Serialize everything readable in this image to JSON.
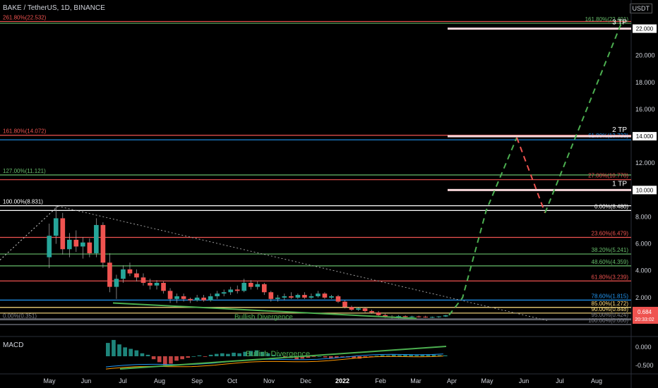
{
  "header": {
    "symbol": "BAKE / TetherUS, 1D, BINANCE",
    "unit": "USDT"
  },
  "macd": {
    "title": "MACD",
    "ticks": [
      "0.000",
      "-0.500"
    ]
  },
  "colors": {
    "up": "#26a69a",
    "down": "#ef5350",
    "wick": "#b0b0b0"
  },
  "chart_data": {
    "type": "candlestick",
    "x_labels": [
      "May",
      "Jun",
      "Jul",
      "Aug",
      "Sep",
      "Oct",
      "Nov",
      "Dec",
      "2022",
      "Feb",
      "Mar",
      "Apr",
      "May",
      "Jun",
      "Jul",
      "Aug"
    ],
    "y_ticks": [
      "22.000",
      "20.000",
      "18.000",
      "16.000",
      "14.000",
      "12.000",
      "10.000",
      "8.000",
      "6.000",
      "4.000",
      "2.000"
    ],
    "ylim": [
      0,
      23.5
    ],
    "price_label": {
      "value": "0.684",
      "countdown": "20:33:02"
    },
    "fib_left": [
      {
        "label": "261.80%(22.532)",
        "value": 22.532,
        "color": "#ef5350"
      },
      {
        "label": "161.80%(14.072)",
        "value": 14.072,
        "color": "#ef5350"
      },
      {
        "label": "127.00%(11.121)",
        "value": 11.121,
        "color": "#66bb6a"
      },
      {
        "label": "100.00%(8.831)",
        "value": 8.831,
        "color": "#ffffff"
      },
      {
        "label": "0.00%(0.351)",
        "value": 0.351,
        "color": "#787b86"
      }
    ],
    "fib_right": [
      {
        "label": "161.80%(22.401)",
        "value": 22.401,
        "color": "#66bb6a"
      },
      {
        "label": "61.80%(13.733)",
        "value": 13.733,
        "color": "#2196f3"
      },
      {
        "label": "27.00%(10.770)",
        "value": 10.77,
        "color": "#ef5350"
      },
      {
        "label": "0.00%(8.480)",
        "value": 8.48,
        "color": "#ffffff"
      },
      {
        "label": "23.60%(6.479)",
        "value": 6.479,
        "color": "#ef5350"
      },
      {
        "label": "38.20%(5.241)",
        "value": 5.241,
        "color": "#66bb6a"
      },
      {
        "label": "48.60%(4.359)",
        "value": 4.359,
        "color": "#66bb6a"
      },
      {
        "label": "61.80%(3.239)",
        "value": 3.239,
        "color": "#ef5350"
      },
      {
        "label": "78.60%(1.815)",
        "value": 1.815,
        "color": "#2196f3"
      },
      {
        "label": "85.00%(1.272)",
        "value": 1.272,
        "color": "#ffe082"
      },
      {
        "label": "90.00%(0.848)",
        "value": 0.848,
        "color": "#ffe082"
      },
      {
        "label": "95.00%(0.424)",
        "value": 0.424,
        "color": "#787b86"
      },
      {
        "label": "100.00%(0.000)",
        "value": 0.0,
        "color": "#787b86"
      }
    ],
    "targets": [
      {
        "label": "3 TP",
        "value": 22.0,
        "tag": "22.000"
      },
      {
        "label": "2 TP",
        "value": 14.0,
        "tag": "14.000"
      },
      {
        "label": "1 TP",
        "value": 10.0,
        "tag": "10.000"
      }
    ],
    "targets_axis": [
      "22.000",
      "14.000",
      "10.000"
    ],
    "annotations": [
      "Bullish Divergence",
      "Bullish Divergence"
    ],
    "candles": [
      {
        "o": 5.0,
        "h": 7.5,
        "l": 4.2,
        "c": 6.6
      },
      {
        "o": 6.6,
        "h": 8.8,
        "l": 6.0,
        "c": 7.9
      },
      {
        "o": 7.9,
        "h": 8.3,
        "l": 5.2,
        "c": 5.6
      },
      {
        "o": 5.6,
        "h": 6.8,
        "l": 5.0,
        "c": 6.3
      },
      {
        "o": 6.3,
        "h": 7.0,
        "l": 5.4,
        "c": 5.8
      },
      {
        "o": 5.8,
        "h": 6.5,
        "l": 4.9,
        "c": 6.1
      },
      {
        "o": 6.1,
        "h": 6.4,
        "l": 5.0,
        "c": 5.3
      },
      {
        "o": 5.3,
        "h": 7.9,
        "l": 5.0,
        "c": 7.4
      },
      {
        "o": 7.4,
        "h": 7.6,
        "l": 4.2,
        "c": 4.6
      },
      {
        "o": 4.6,
        "h": 5.3,
        "l": 2.4,
        "c": 2.8
      },
      {
        "o": 2.8,
        "h": 3.7,
        "l": 1.9,
        "c": 3.4
      },
      {
        "o": 3.4,
        "h": 4.4,
        "l": 3.1,
        "c": 4.1
      },
      {
        "o": 4.1,
        "h": 4.6,
        "l": 3.6,
        "c": 3.8
      },
      {
        "o": 3.8,
        "h": 4.1,
        "l": 3.2,
        "c": 3.5
      },
      {
        "o": 3.5,
        "h": 3.8,
        "l": 2.9,
        "c": 3.1
      },
      {
        "o": 3.1,
        "h": 3.4,
        "l": 2.6,
        "c": 2.9
      },
      {
        "o": 2.9,
        "h": 3.3,
        "l": 2.6,
        "c": 3.1
      },
      {
        "o": 3.1,
        "h": 3.2,
        "l": 2.3,
        "c": 2.5
      },
      {
        "o": 2.5,
        "h": 2.7,
        "l": 1.6,
        "c": 1.9
      },
      {
        "o": 1.9,
        "h": 2.3,
        "l": 1.6,
        "c": 2.1
      },
      {
        "o": 2.1,
        "h": 2.3,
        "l": 1.7,
        "c": 1.9
      },
      {
        "o": 1.9,
        "h": 2.0,
        "l": 1.6,
        "c": 1.8
      },
      {
        "o": 1.8,
        "h": 2.2,
        "l": 1.7,
        "c": 2.0
      },
      {
        "o": 2.0,
        "h": 2.2,
        "l": 1.7,
        "c": 1.8
      },
      {
        "o": 1.8,
        "h": 2.3,
        "l": 1.7,
        "c": 2.1
      },
      {
        "o": 2.1,
        "h": 2.5,
        "l": 1.9,
        "c": 2.3
      },
      {
        "o": 2.3,
        "h": 2.6,
        "l": 2.1,
        "c": 2.4
      },
      {
        "o": 2.4,
        "h": 2.8,
        "l": 2.2,
        "c": 2.6
      },
      {
        "o": 2.6,
        "h": 2.9,
        "l": 2.3,
        "c": 2.5
      },
      {
        "o": 2.5,
        "h": 3.4,
        "l": 2.4,
        "c": 3.1
      },
      {
        "o": 3.1,
        "h": 3.3,
        "l": 2.6,
        "c": 2.8
      },
      {
        "o": 2.8,
        "h": 3.2,
        "l": 2.6,
        "c": 3.0
      },
      {
        "o": 3.0,
        "h": 3.1,
        "l": 2.2,
        "c": 2.4
      },
      {
        "o": 2.4,
        "h": 2.5,
        "l": 1.7,
        "c": 1.9
      },
      {
        "o": 1.9,
        "h": 2.2,
        "l": 1.7,
        "c": 2.0
      },
      {
        "o": 2.0,
        "h": 2.3,
        "l": 1.8,
        "c": 2.1
      },
      {
        "o": 2.1,
        "h": 2.4,
        "l": 1.9,
        "c": 2.0
      },
      {
        "o": 2.0,
        "h": 2.3,
        "l": 1.9,
        "c": 2.2
      },
      {
        "o": 2.2,
        "h": 2.4,
        "l": 1.9,
        "c": 2.0
      },
      {
        "o": 2.0,
        "h": 2.3,
        "l": 1.9,
        "c": 2.1
      },
      {
        "o": 2.1,
        "h": 2.5,
        "l": 2.0,
        "c": 2.3
      },
      {
        "o": 2.3,
        "h": 2.4,
        "l": 1.9,
        "c": 2.0
      },
      {
        "o": 2.0,
        "h": 2.2,
        "l": 1.9,
        "c": 2.1
      },
      {
        "o": 2.1,
        "h": 2.2,
        "l": 1.6,
        "c": 1.7
      },
      {
        "o": 1.7,
        "h": 1.8,
        "l": 1.2,
        "c": 1.3
      },
      {
        "o": 1.3,
        "h": 1.4,
        "l": 1.0,
        "c": 1.1
      },
      {
        "o": 1.1,
        "h": 1.3,
        "l": 1.0,
        "c": 1.2
      },
      {
        "o": 1.2,
        "h": 1.3,
        "l": 0.9,
        "c": 1.0
      },
      {
        "o": 1.0,
        "h": 1.1,
        "l": 0.8,
        "c": 0.9
      },
      {
        "o": 0.9,
        "h": 1.0,
        "l": 0.6,
        "c": 0.7
      },
      {
        "o": 0.7,
        "h": 0.8,
        "l": 0.5,
        "c": 0.6
      },
      {
        "o": 0.6,
        "h": 0.7,
        "l": 0.45,
        "c": 0.55
      },
      {
        "o": 0.55,
        "h": 0.7,
        "l": 0.45,
        "c": 0.62
      },
      {
        "o": 0.62,
        "h": 0.68,
        "l": 0.5,
        "c": 0.56
      },
      {
        "o": 0.56,
        "h": 0.65,
        "l": 0.5,
        "c": 0.6
      },
      {
        "o": 0.6,
        "h": 0.66,
        "l": 0.52,
        "c": 0.58
      },
      {
        "o": 0.58,
        "h": 0.65,
        "l": 0.5,
        "c": 0.55
      },
      {
        "o": 0.55,
        "h": 0.6,
        "l": 0.48,
        "c": 0.56
      },
      {
        "o": 0.56,
        "h": 0.62,
        "l": 0.5,
        "c": 0.6
      },
      {
        "o": 0.6,
        "h": 0.72,
        "l": 0.56,
        "c": 0.68
      }
    ],
    "projection": {
      "green_1": [
        [
          0.0,
          0.7
        ],
        [
          0.2,
          2.0
        ],
        [
          0.55,
          8.5
        ],
        [
          1.0,
          13.9
        ]
      ],
      "red_down": [
        [
          0.0,
          13.9
        ],
        [
          1.0,
          8.3
        ]
      ],
      "green_2": [
        [
          0.0,
          8.3
        ],
        [
          1.0,
          22.4
        ]
      ]
    },
    "macd_hist": [
      0.45,
      0.55,
      0.4,
      0.3,
      0.25,
      0.2,
      0.1,
      0.05,
      -0.1,
      -0.2,
      -0.3,
      -0.25,
      -0.15,
      -0.1,
      -0.05,
      0.0,
      0.03,
      -0.02,
      0.05,
      0.08,
      0.1,
      0.08,
      0.12,
      0.1,
      0.15,
      0.18,
      0.2,
      0.15,
      0.1,
      0.05,
      0.02,
      -0.03,
      -0.06,
      -0.1,
      -0.08,
      -0.05,
      -0.02,
      0.0,
      -0.04,
      -0.08,
      -0.05,
      -0.02,
      -0.04,
      -0.06,
      -0.08,
      -0.05,
      -0.03,
      0.02,
      0.04,
      0.03,
      0.05,
      0.04,
      0.06,
      0.05,
      0.04,
      0.05,
      0.06,
      0.05,
      0.04,
      0.03
    ]
  }
}
